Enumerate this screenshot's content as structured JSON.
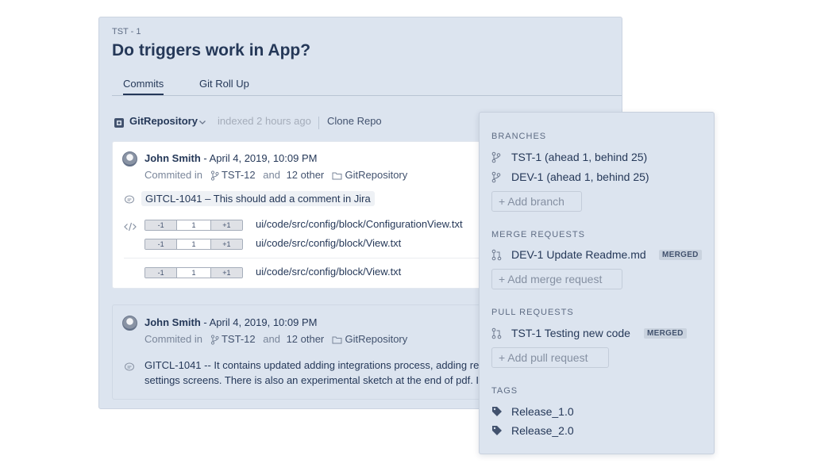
{
  "issue": {
    "key": "TST - 1",
    "title": "Do triggers work in App?"
  },
  "tabs": [
    {
      "label": "Commits",
      "active": true
    },
    {
      "label": "Git Roll Up",
      "active": false
    }
  ],
  "toolbar": {
    "repo_icon": "git-repo-icon",
    "repo_name": "GitRepository",
    "indexed_text": "indexed 2 hours ago",
    "clone_label": "Clone Repo"
  },
  "commits": [
    {
      "author": "John Smith",
      "date": " - April 4, 2019, 10:09 PM",
      "committed_in": "Commited in",
      "branch": "TST-12",
      "and_text": "and",
      "other": "12 other",
      "repo": "GitRepository",
      "message": "GITCL-1041 – This should add a comment in Jira",
      "files": [
        {
          "minus": "-1",
          "mid": "1",
          "plus": "+1",
          "path": "ui/code/src/config/block/ConfigurationView.txt"
        },
        {
          "minus": "-1",
          "mid": "1",
          "plus": "+1",
          "path": "ui/code/src/config/block/View.txt"
        },
        {
          "minus": "-1",
          "mid": "1",
          "plus": "+1",
          "path": "ui/code/src/config/block/View.txt"
        }
      ]
    },
    {
      "author": "John Smith",
      "date": " - April 4, 2019, 10:09 PM",
      "committed_in": "Commited in",
      "branch": "TST-12",
      "and_text": "and",
      "other": "12 other",
      "repo": "GitRepository",
      "message_line1": "GITCL-1041 -- It contains updated adding integrations process, adding re",
      "message_line2": "settings screens. There is also an experimental sketch at the end of pdf. I"
    }
  ],
  "side_panel": {
    "branches_title": "BRANCHES",
    "branches": [
      {
        "label": "TST-1 (ahead 1, behind 25)",
        "icon": "branch-icon"
      },
      {
        "label": "DEV-1 (ahead 1, behind 25)",
        "icon": "branch-icon"
      }
    ],
    "add_branch": "+ Add branch",
    "merge_title": "MERGE REQUESTS",
    "merge_requests": [
      {
        "label": "DEV-1 Update Readme.md",
        "badge": "MERGED",
        "icon": "pull-request-icon"
      }
    ],
    "add_merge": "+ Add merge request",
    "pull_title": "PULL REQUESTS",
    "pull_requests": [
      {
        "label": "TST-1 Testing new code",
        "badge": "MERGED",
        "icon": "pull-request-icon"
      }
    ],
    "add_pull": "+ Add pull request",
    "tags_title": "TAGS",
    "tags": [
      {
        "label": "Release_1.0",
        "icon": "tag-icon"
      },
      {
        "label": "Release_2.0",
        "icon": "tag-icon"
      }
    ]
  }
}
